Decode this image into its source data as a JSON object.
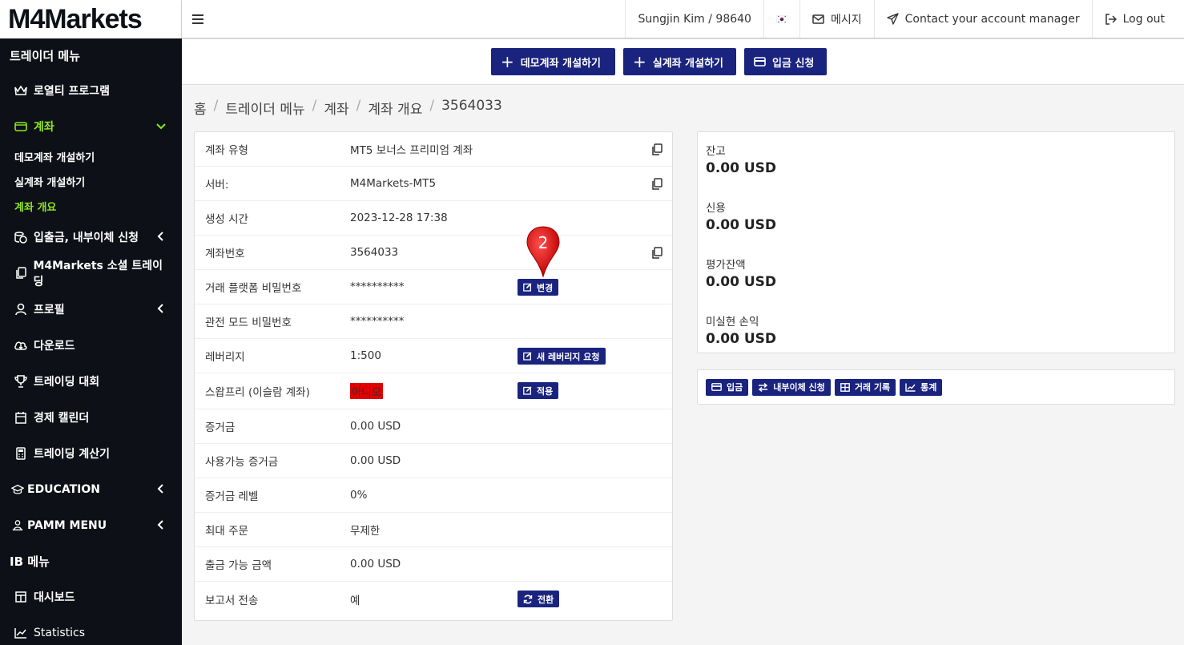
{
  "brand": {
    "logo": "M4Markets"
  },
  "sidebar": {
    "trader_section": "트레이더 메뉴",
    "loyalty": "로열티 프로그램",
    "account": "계좌",
    "account_subs": [
      "데모계좌 개설하기",
      "실계좌 개설하기",
      "계좌 개요"
    ],
    "deposit": "입출금, 내부이체 신청",
    "social": "M4Markets 소셜 트레이딩",
    "profile": "프로필",
    "download": "다운로드",
    "contest": "트레이딩 대회",
    "calendar": "경제 캘린더",
    "calculator": "트레이딩 계산기",
    "education": "EDUCATION",
    "pamm": "PAMM MENU",
    "ib_section": "IB 메뉴",
    "dashboard": "대시보드",
    "statistics": "Statistics"
  },
  "topbar": {
    "user": "Sungjin Kim / 98640",
    "messages": "메시지",
    "contact": "Contact your account manager",
    "logout": "Log out"
  },
  "actions": {
    "demo": "데모계좌 개설하기",
    "live": "실계좌 개설하기",
    "deposit": "입금 신청"
  },
  "breadcrumb": [
    "홈",
    "트레이더 메뉴",
    "계좌",
    "계좌 개요",
    "3564033"
  ],
  "info_rows": [
    {
      "k": "계좌 유형",
      "v": "MT5 보너스 프리미엄 계좌"
    },
    {
      "k": "서버:",
      "v": "M4Markets-MT5"
    },
    {
      "k": "생성 시간",
      "v": "2023-12-28 17:38"
    },
    {
      "k": "계좌번호",
      "v": "3564033"
    },
    {
      "k": "거래 플랫폼 비밀번호",
      "v": "**********"
    },
    {
      "k": "관전 모드 비밀번호",
      "v": "**********"
    },
    {
      "k": "레버리지",
      "v": "1:500"
    },
    {
      "k": "스왑프리 (이슬람 계좌)",
      "v": "아니오"
    },
    {
      "k": "증거금",
      "v": "0.00 USD"
    },
    {
      "k": "사용가능 증거금",
      "v": "0.00 USD"
    },
    {
      "k": "증거금 레벨",
      "v": "0%"
    },
    {
      "k": "최대 주문",
      "v": "무제한"
    },
    {
      "k": "출금 가능 금액",
      "v": "0.00 USD"
    },
    {
      "k": "보고서 전송",
      "v": "예"
    }
  ],
  "row_buttons": {
    "change": "변경",
    "leverage": "새 레버리지 요청",
    "apply": "적용",
    "switch": "전환"
  },
  "balance": [
    {
      "label": "잔고",
      "value": "0.00 USD"
    },
    {
      "label": "신용",
      "value": "0.00 USD"
    },
    {
      "label": "평가잔액",
      "value": "0.00 USD"
    },
    {
      "label": "미실현 손익",
      "value": "0.00 USD"
    }
  ],
  "links": {
    "deposit": "입금",
    "transfer": "내부이체 신청",
    "history": "거래 기록",
    "stats": "통계"
  },
  "marker": {
    "number": "2",
    "color": "#e01010"
  }
}
